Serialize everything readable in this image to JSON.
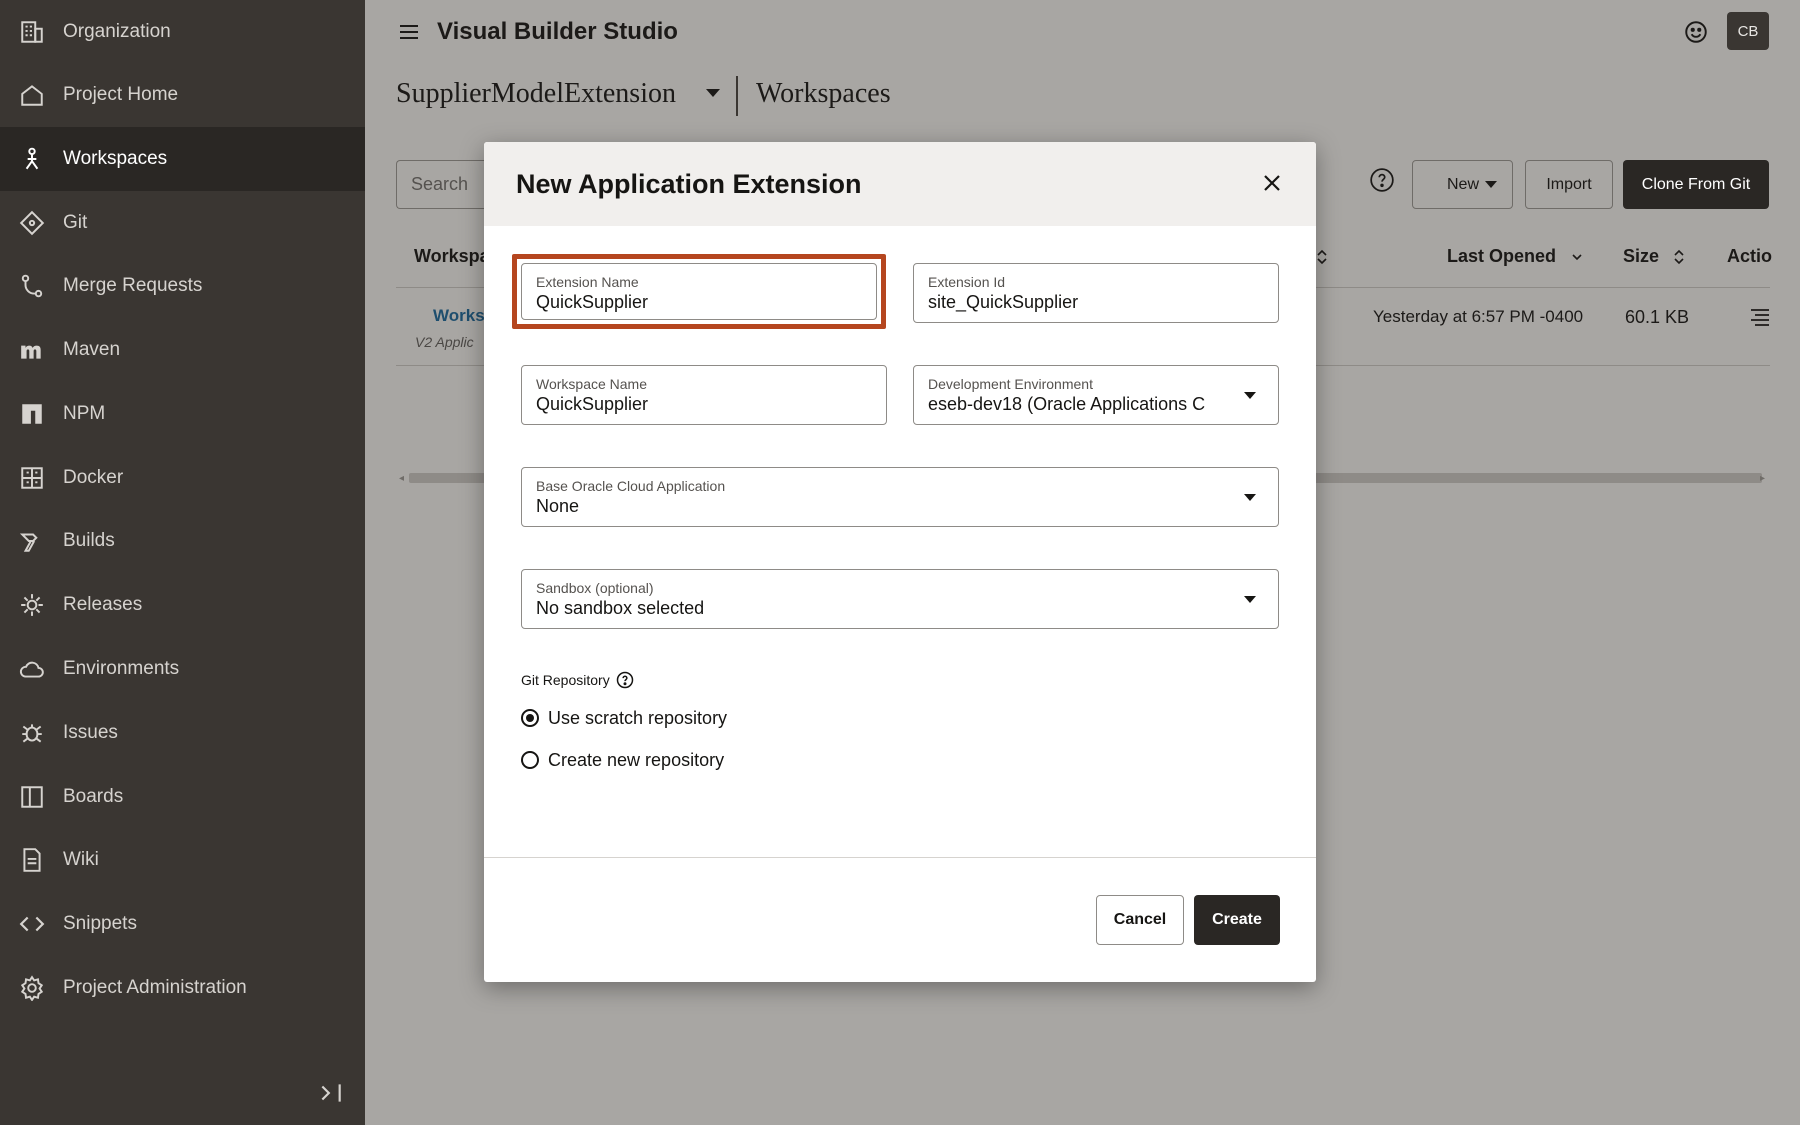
{
  "sidebar": {
    "items": [
      {
        "label": "Organization",
        "icon": "building-icon"
      },
      {
        "label": "Project Home",
        "icon": "home-icon"
      },
      {
        "label": "Workspaces",
        "icon": "workspace-person-icon",
        "active": true
      },
      {
        "label": "Git",
        "icon": "git-diamond-icon"
      },
      {
        "label": "Merge Requests",
        "icon": "merge-icon"
      },
      {
        "label": "Maven",
        "icon": "maven-icon"
      },
      {
        "label": "NPM",
        "icon": "npm-icon"
      },
      {
        "label": "Docker",
        "icon": "docker-icon"
      },
      {
        "label": "Builds",
        "icon": "hammer-icon"
      },
      {
        "label": "Releases",
        "icon": "gear-badge-icon"
      },
      {
        "label": "Environments",
        "icon": "cloud-icon"
      },
      {
        "label": "Issues",
        "icon": "bug-icon"
      },
      {
        "label": "Boards",
        "icon": "board-icon"
      },
      {
        "label": "Wiki",
        "icon": "document-icon"
      },
      {
        "label": "Snippets",
        "icon": "code-icon"
      },
      {
        "label": "Project Administration",
        "icon": "settings-icon"
      }
    ]
  },
  "header": {
    "app_title": "Visual Builder Studio",
    "avatar_initials": "CB",
    "project_name": "SupplierModelExtension",
    "section_name": "Workspaces"
  },
  "toolbar": {
    "search_placeholder": "Search",
    "new_label": "New",
    "import_label": "Import",
    "clone_label": "Clone From Git"
  },
  "table": {
    "col_workspace": "Workspa",
    "col_last_opened": "Last Opened",
    "col_size": "Size",
    "col_actions": "Actio",
    "row": {
      "name": "Works",
      "sub": "V2 Applic",
      "last_opened": "Yesterday at 6:57 PM -0400",
      "size": "60.1 KB"
    }
  },
  "dialog": {
    "title": "New Application Extension",
    "extension_name_label": "Extension Name",
    "extension_name_value": "QuickSupplier",
    "extension_id_label": "Extension Id",
    "extension_id_value": "site_QuickSupplier",
    "workspace_name_label": "Workspace Name",
    "workspace_name_value": "QuickSupplier",
    "dev_env_label": "Development Environment",
    "dev_env_value": "eseb-dev18 (Oracle Applications C",
    "base_app_label": "Base Oracle Cloud Application",
    "base_app_value": "None",
    "sandbox_label": "Sandbox (optional)",
    "sandbox_value": "No sandbox selected",
    "git_repo_label": "Git Repository",
    "radio_scratch": "Use scratch repository",
    "radio_new": "Create new repository",
    "cancel_label": "Cancel",
    "create_label": "Create"
  },
  "colors": {
    "sidebar_bg": "#3a3632",
    "sidebar_active": "#2a2724",
    "focus_ring": "#b5461f",
    "primary_button": "#2a2724",
    "link": "#1e4e6e"
  }
}
